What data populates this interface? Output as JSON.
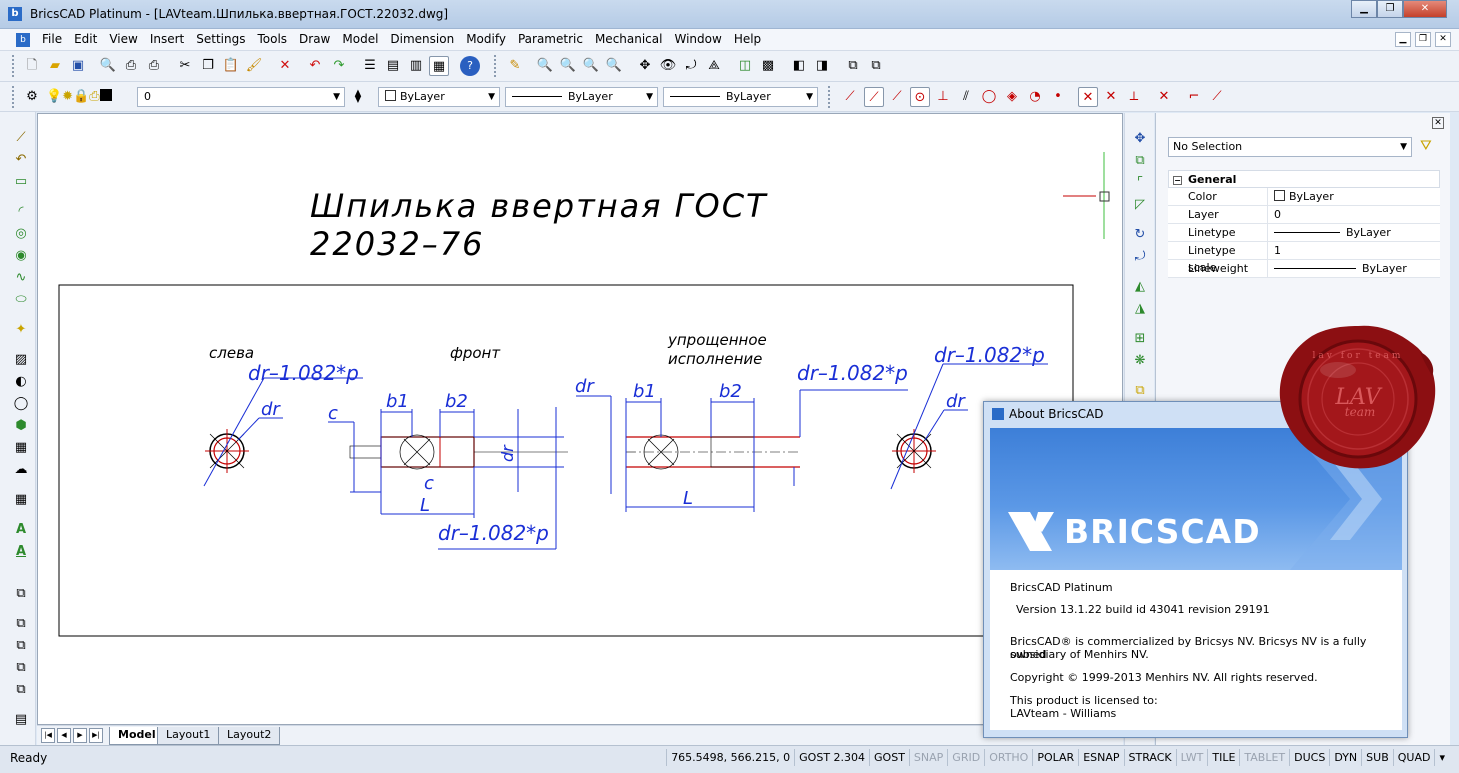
{
  "window": {
    "title": "BricsCAD Platinum - [LAVteam.Шпилька.ввертная.ГОСТ.22032.dwg]",
    "minimize": "▁",
    "maximize": "❐",
    "close": "✕"
  },
  "menu": {
    "items": [
      "File",
      "Edit",
      "View",
      "Insert",
      "Settings",
      "Tools",
      "Draw",
      "Model",
      "Dimension",
      "Modify",
      "Parametric",
      "Mechanical",
      "Window",
      "Help"
    ]
  },
  "layers_toolbar": {
    "layer_value": "0",
    "color_value": "ByLayer",
    "linetype_value": "ByLayer",
    "lineweight_value": "ByLayer"
  },
  "drawing": {
    "title_line1": "Шпилька ввертная ГОСТ",
    "title_line2": "22032–76",
    "label_left": "слева",
    "label_front": "фронт",
    "label_simplified_1": "упрощенное",
    "label_simplified_2": "исполнение",
    "dim_dr_p": "dr–1.082*p",
    "dim_dr": "dr",
    "dim_b1": "b1",
    "dim_b2": "b2",
    "dim_c": "c",
    "dim_L": "L"
  },
  "properties": {
    "selection": "No Selection",
    "group": "General",
    "rows": [
      {
        "key": "Color",
        "value": "ByLayer"
      },
      {
        "key": "Layer",
        "value": "0"
      },
      {
        "key": "Linetype",
        "value": "ByLayer"
      },
      {
        "key": "Linetype scale",
        "value": "1"
      },
      {
        "key": "Lineweight",
        "value": "ByLayer"
      }
    ]
  },
  "tabs": {
    "items": [
      "Model",
      "Layout1",
      "Layout2"
    ]
  },
  "status": {
    "ready": "Ready",
    "coords": "765.5498, 566.215, 0",
    "gost": "GOST 2.304",
    "cells": [
      {
        "label": "GOST",
        "on": true
      },
      {
        "label": "SNAP",
        "on": false
      },
      {
        "label": "GRID",
        "on": false
      },
      {
        "label": "ORTHO",
        "on": false
      },
      {
        "label": "POLAR",
        "on": true
      },
      {
        "label": "ESNAP",
        "on": true
      },
      {
        "label": "STRACK",
        "on": true
      },
      {
        "label": "LWT",
        "on": false
      },
      {
        "label": "TILE",
        "on": true
      },
      {
        "label": "TABLET",
        "on": false
      },
      {
        "label": "DUCS",
        "on": true
      },
      {
        "label": "DYN",
        "on": true
      },
      {
        "label": "SUB",
        "on": true
      },
      {
        "label": "QUAD",
        "on": true
      }
    ]
  },
  "about": {
    "title": "About BricsCAD",
    "logo": "BRICSCAD",
    "product": "BricsCAD Platinum",
    "version": "Version 13.1.22 build id 43041 revision 29191",
    "commercial_1": "BricsCAD® is commercialized by Bricsys NV. Bricsys NV is a fully owned",
    "commercial_2": "subsidiary of Menhirs NV.",
    "copyright": "Copyright © 1999-2013 Menhirs NV. All rights reserved.",
    "license_1": "This product is licensed to:",
    "license_2": "LAVteam - Williams"
  },
  "seal": {
    "text": "LAV",
    "sub": "team",
    "ring": "lav for team"
  },
  "colors": {
    "dimension_blue": "#1a2fd6",
    "red_line": "#c40000",
    "wax_red": "#8c0f12"
  }
}
